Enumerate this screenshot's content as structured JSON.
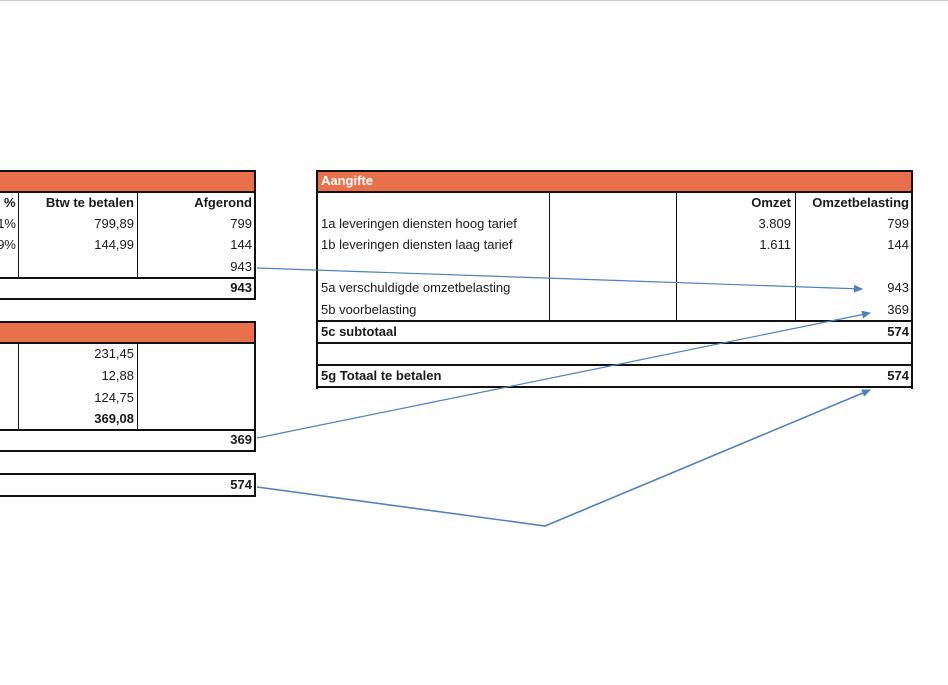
{
  "left_table": {
    "headers": {
      "percent": "%",
      "btw_te_betalen": "Btw te betalen",
      "afgerond": "Afgerond"
    },
    "rows": [
      {
        "pct": "1%",
        "btw": "799,89",
        "afgerond": "799"
      },
      {
        "pct": "9%",
        "btw": "144,99",
        "afgerond": "144"
      }
    ],
    "subtotal_afgerond": "943",
    "total": "943"
  },
  "voorbelasting_table": {
    "values": [
      "231,45",
      "12,88",
      "124,75"
    ],
    "sum": "369,08",
    "total": "369"
  },
  "left_final_total": "574",
  "aangifte": {
    "title": "Aangifte",
    "headers": {
      "omzet": "Omzet",
      "omzetbelasting": "Omzetbelasting"
    },
    "rows": [
      {
        "label": "1a leveringen diensten hoog tarief",
        "omzet": "3.809",
        "belasting": "799"
      },
      {
        "label": "1b leveringen diensten laag tarief",
        "omzet": "1.611",
        "belasting": "144"
      }
    ],
    "row5a": {
      "label": "5a verschuldigde omzetbelasting",
      "value": "943"
    },
    "row5b": {
      "label": "5b voorbelasting",
      "value": "369"
    },
    "row5c": {
      "label": "5c subtotaal",
      "value": "574"
    },
    "row5g": {
      "label": "5g Totaal te betalen",
      "value": "574"
    }
  },
  "colors": {
    "header_orange": "#E8704A",
    "arrow_blue": "#4F81BD",
    "border": "#111111"
  }
}
